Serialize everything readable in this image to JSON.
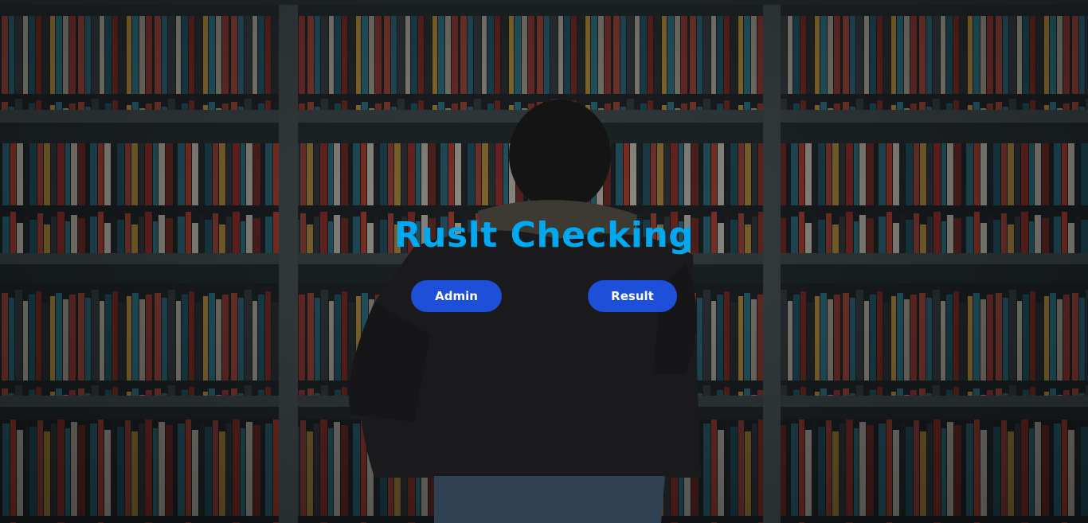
{
  "hero": {
    "title": "Ruslt Checking",
    "admin_label": "Admin",
    "result_label": "Result"
  },
  "colors": {
    "title": "#00a8f0",
    "button_bg": "#1d4fd8",
    "button_text": "#ffffff"
  }
}
